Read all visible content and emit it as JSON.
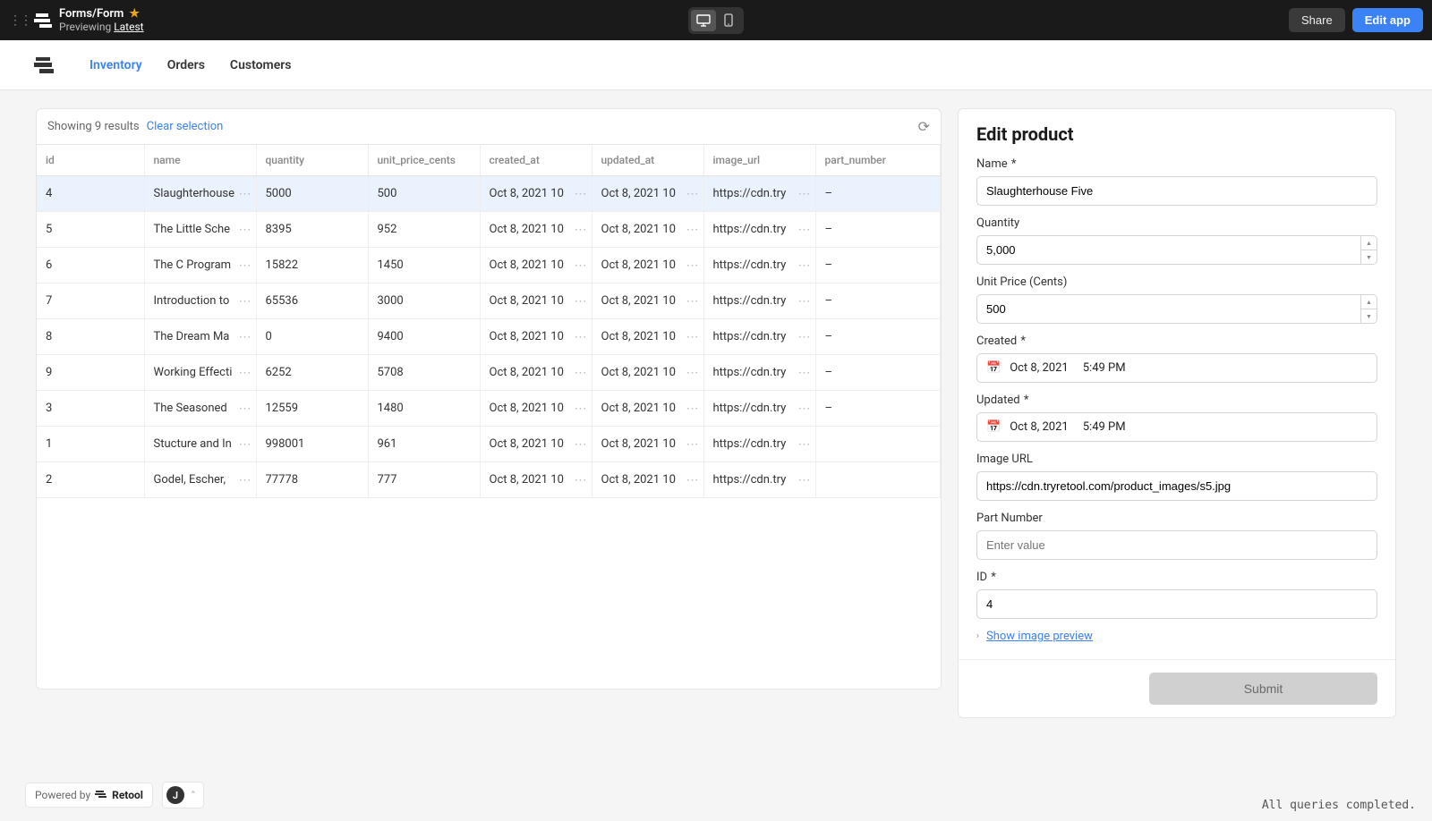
{
  "topbar": {
    "breadcrumb": "Forms/Form",
    "preview_prefix": "Previewing ",
    "preview_link": "Latest",
    "share": "Share",
    "edit_app": "Edit app"
  },
  "nav": {
    "tabs": [
      "Inventory",
      "Orders",
      "Customers"
    ],
    "active": 0
  },
  "table": {
    "status": "Showing 9 results",
    "clear": "Clear selection",
    "columns": [
      "id",
      "name",
      "quantity",
      "unit_price_cents",
      "created_at",
      "updated_at",
      "image_url",
      "part_number"
    ],
    "selected_row": 0,
    "rows": [
      {
        "id": "4",
        "name": "Slaughterhouse",
        "quantity": "5000",
        "unit_price_cents": "500",
        "created_at": "Oct 8, 2021 10",
        "updated_at": "Oct 8, 2021 10",
        "image_url": "https://cdn.try",
        "part_number": "–"
      },
      {
        "id": "5",
        "name": "The Little Sche",
        "quantity": "8395",
        "unit_price_cents": "952",
        "created_at": "Oct 8, 2021 10",
        "updated_at": "Oct 8, 2021 10",
        "image_url": "https://cdn.try",
        "part_number": "–"
      },
      {
        "id": "6",
        "name": "The C Program",
        "quantity": "15822",
        "unit_price_cents": "1450",
        "created_at": "Oct 8, 2021 10",
        "updated_at": "Oct 8, 2021 10",
        "image_url": "https://cdn.try",
        "part_number": "–"
      },
      {
        "id": "7",
        "name": "Introduction to",
        "quantity": "65536",
        "unit_price_cents": "3000",
        "created_at": "Oct 8, 2021 10",
        "updated_at": "Oct 8, 2021 10",
        "image_url": "https://cdn.try",
        "part_number": "–"
      },
      {
        "id": "8",
        "name": "The Dream Ma",
        "quantity": "0",
        "unit_price_cents": "9400",
        "created_at": "Oct 8, 2021 10",
        "updated_at": "Oct 8, 2021 10",
        "image_url": "https://cdn.try",
        "part_number": "–"
      },
      {
        "id": "9",
        "name": "Working Effecti",
        "quantity": "6252",
        "unit_price_cents": "5708",
        "created_at": "Oct 8, 2021 10",
        "updated_at": "Oct 8, 2021 10",
        "image_url": "https://cdn.try",
        "part_number": "–"
      },
      {
        "id": "3",
        "name": "The Seasoned",
        "quantity": "12559",
        "unit_price_cents": "1480",
        "created_at": "Oct 8, 2021 10",
        "updated_at": "Oct 8, 2021 10",
        "image_url": "https://cdn.try",
        "part_number": "–"
      },
      {
        "id": "1",
        "name": "Stucture and In",
        "quantity": "998001",
        "unit_price_cents": "961",
        "created_at": "Oct 8, 2021 10",
        "updated_at": "Oct 8, 2021 10",
        "image_url": "https://cdn.try",
        "part_number": ""
      },
      {
        "id": "2",
        "name": "Godel, Escher,",
        "quantity": "77778",
        "unit_price_cents": "777",
        "created_at": "Oct 8, 2021 10",
        "updated_at": "Oct 8, 2021 10",
        "image_url": "https://cdn.try",
        "part_number": ""
      }
    ]
  },
  "form": {
    "title": "Edit product",
    "labels": {
      "name": "Name",
      "quantity": "Quantity",
      "unit_price": "Unit Price (Cents)",
      "created": "Created",
      "updated": "Updated",
      "image_url": "Image URL",
      "part_number": "Part Number",
      "id": "ID"
    },
    "values": {
      "name": "Slaughterhouse Five",
      "quantity": "5,000",
      "unit_price": "500",
      "created_date": "Oct 8, 2021",
      "created_time": "5:49 PM",
      "updated_date": "Oct 8, 2021",
      "updated_time": "5:49 PM",
      "image_url": "https://cdn.tryretool.com/product_images/s5.jpg",
      "part_number": "",
      "id": "4"
    },
    "placeholders": {
      "part_number": "Enter value"
    },
    "image_preview": "Show image preview",
    "submit": "Submit"
  },
  "footer": {
    "powered": "Powered by",
    "brand": "Retool",
    "user_initial": "J",
    "status": "All queries completed."
  }
}
